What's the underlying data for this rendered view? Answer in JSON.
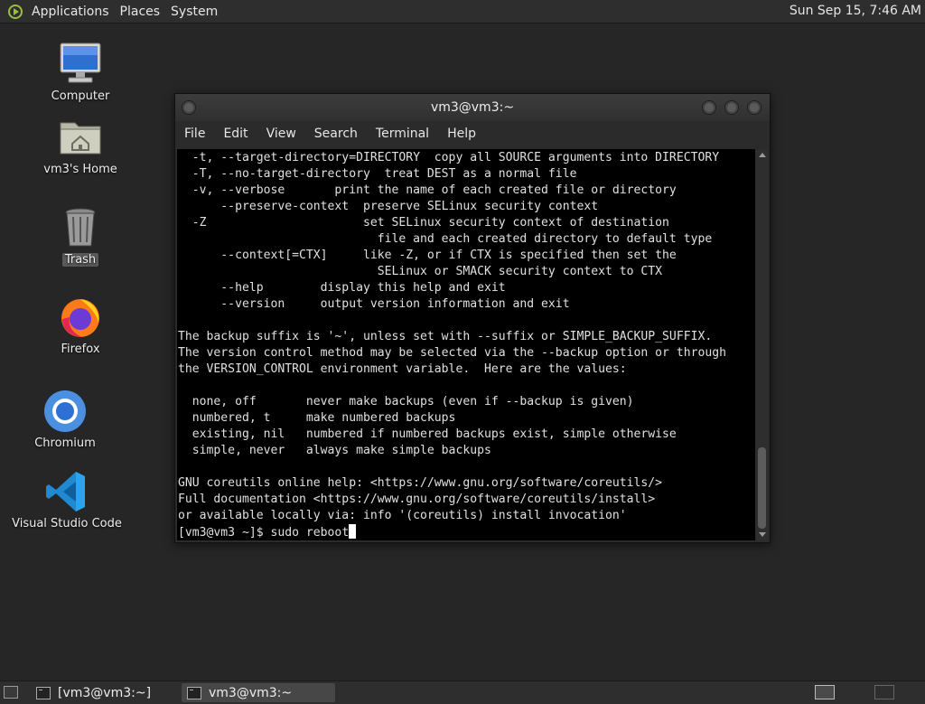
{
  "top_panel": {
    "menus": [
      "Applications",
      "Places",
      "System"
    ],
    "clock": "Sun Sep 15,  7:46 AM"
  },
  "desktop_icons": [
    {
      "label": "Computer",
      "icon": "computer-icon"
    },
    {
      "label": "vm3's Home",
      "icon": "home-folder-icon"
    },
    {
      "label": "Trash",
      "icon": "trash-icon"
    },
    {
      "label": "Firefox",
      "icon": "firefox-icon"
    },
    {
      "label": "Chromium",
      "icon": "chromium-icon"
    },
    {
      "label": "Visual Studio Code",
      "icon": "vscode-icon"
    }
  ],
  "terminal": {
    "title": "vm3@vm3:~",
    "menus": [
      "File",
      "Edit",
      "View",
      "Search",
      "Terminal",
      "Help"
    ],
    "output_lines": [
      "  -t, --target-directory=DIRECTORY  copy all SOURCE arguments into DIRECTORY",
      "  -T, --no-target-directory  treat DEST as a normal file",
      "  -v, --verbose       print the name of each created file or directory",
      "      --preserve-context  preserve SELinux security context",
      "  -Z                      set SELinux security context of destination",
      "                            file and each created directory to default type",
      "      --context[=CTX]     like -Z, or if CTX is specified then set the",
      "                            SELinux or SMACK security context to CTX",
      "      --help        display this help and exit",
      "      --version     output version information and exit",
      "",
      "The backup suffix is '~', unless set with --suffix or SIMPLE_BACKUP_SUFFIX.",
      "The version control method may be selected via the --backup option or through",
      "the VERSION_CONTROL environment variable.  Here are the values:",
      "",
      "  none, off       never make backups (even if --backup is given)",
      "  numbered, t     make numbered backups",
      "  existing, nil   numbered if numbered backups exist, simple otherwise",
      "  simple, never   always make simple backups",
      "",
      "GNU coreutils online help: <https://www.gnu.org/software/coreutils/>",
      "Full documentation <https://www.gnu.org/software/coreutils/install>",
      "or available locally via: info '(coreutils) install invocation'"
    ],
    "prompt": "[vm3@vm3 ~]$ ",
    "command": "sudo reboot"
  },
  "taskbar": {
    "tasks": [
      "[vm3@vm3:~]",
      "vm3@vm3:~"
    ]
  }
}
